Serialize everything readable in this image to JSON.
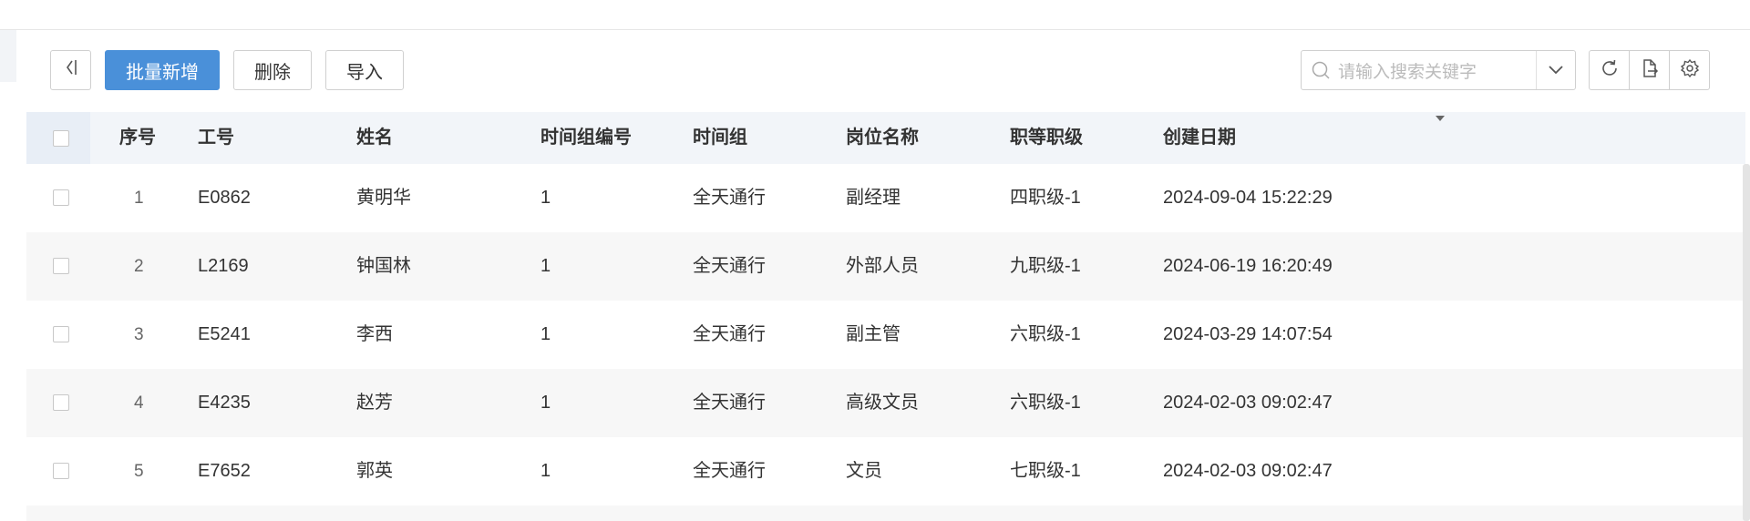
{
  "toolbar": {
    "batch_add_label": "批量新增",
    "delete_label": "删除",
    "import_label": "导入"
  },
  "search": {
    "placeholder": "请输入搜索关键字"
  },
  "table": {
    "columns": {
      "index": "序号",
      "employee_no": "工号",
      "name": "姓名",
      "time_group_no": "时间组编号",
      "time_group": "时间组",
      "position": "岗位名称",
      "grade": "职等职级",
      "created": "创建日期"
    },
    "rows": [
      {
        "index": "1",
        "employee_no": "E0862",
        "name": "黄明华",
        "time_group_no": "1",
        "time_group": "全天通行",
        "position": "副经理",
        "grade": "四职级-1",
        "created": "2024-09-04 15:22:29"
      },
      {
        "index": "2",
        "employee_no": "L2169",
        "name": "钟国林",
        "time_group_no": "1",
        "time_group": "全天通行",
        "position": "外部人员",
        "grade": "九职级-1",
        "created": "2024-06-19 16:20:49"
      },
      {
        "index": "3",
        "employee_no": "E5241",
        "name": "李西",
        "time_group_no": "1",
        "time_group": "全天通行",
        "position": "副主管",
        "grade": "六职级-1",
        "created": "2024-03-29 14:07:54"
      },
      {
        "index": "4",
        "employee_no": "E4235",
        "name": "赵芳",
        "time_group_no": "1",
        "time_group": "全天通行",
        "position": "高级文员",
        "grade": "六职级-1",
        "created": "2024-02-03 09:02:47"
      },
      {
        "index": "5",
        "employee_no": "E7652",
        "name": "郭英",
        "time_group_no": "1",
        "time_group": "全天通行",
        "position": "文员",
        "grade": "七职级-1",
        "created": "2024-02-03 09:02:47"
      }
    ]
  },
  "icons": {
    "collapse": "collapse-left-icon",
    "search": "search-icon",
    "dropdown": "chevron-down-icon",
    "refresh": "refresh-icon",
    "export": "export-file-icon",
    "settings": "gear-icon"
  },
  "colors": {
    "primary": "#4a90d9",
    "header_bg": "#f2f5f9",
    "row_alt_bg": "#f7f7f7"
  }
}
